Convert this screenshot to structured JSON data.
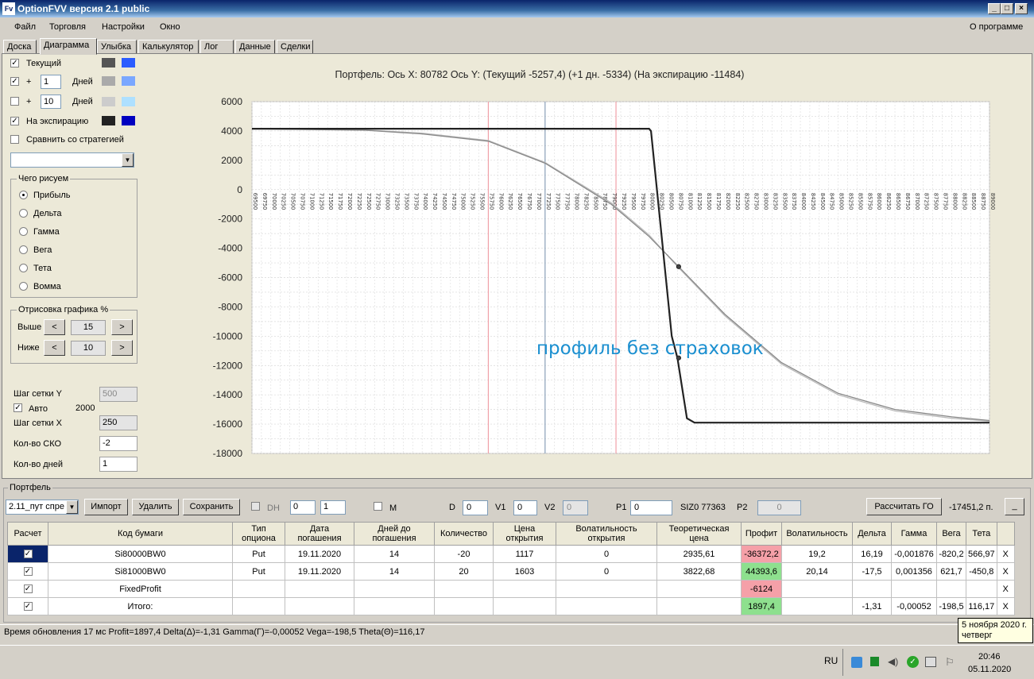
{
  "window": {
    "title": "OptionFVV версия 2.1 public",
    "icon_label": "Fv"
  },
  "menu": {
    "file": "Файл",
    "trade": "Торговля",
    "settings": "Настройки",
    "window": "Окно",
    "about": "О программе"
  },
  "tabs": [
    "Доска",
    "Диаграмма",
    "Улыбка",
    "Калькулятор",
    "Лог",
    "Данные",
    "Сделки"
  ],
  "left": {
    "current_label": "Текущий",
    "plus": "+",
    "days1": "1",
    "days_label": "Дней",
    "days2": "10",
    "expiration_label": "На экспирацию",
    "compare_label": "Сравнить со стратегией",
    "colors": {
      "current": [
        "#555555",
        "#2b5cff"
      ],
      "d1": [
        "#aaaaaa",
        "#7aa7ff"
      ],
      "d10": [
        "#cccccc",
        "#aee0ff"
      ],
      "exp": [
        "#222222",
        "#0000c0"
      ]
    },
    "what_group": "Чего рисуем",
    "radios": [
      "Прибыль",
      "Дельта",
      "Гамма",
      "Вега",
      "Тета",
      "Вомма"
    ],
    "draw_group": "Отрисовка графика %",
    "above_label": "Выше",
    "above_value": "15",
    "below_label": "Ниже",
    "below_value": "10",
    "grid_y_label": "Шаг сетки Y",
    "grid_y_value": "500",
    "auto_label": "Авто",
    "auto_value": "2000",
    "grid_x_label": "Шаг сетки X",
    "grid_x_value": "250",
    "sko_label": "Кол-во СКО",
    "sko_value": "-2",
    "days_count_label": "Кол-во дней",
    "days_count_value": "1",
    "btn_left": "<",
    "btn_right": ">"
  },
  "chart_header": "Портфель: Ось X: 80782 Ось Y:  (Текущий -5257,4)  (+1 дн. -5334)  (На экспирацию -11484)",
  "chart_annotation": "профиль без страховок",
  "chart_data": {
    "type": "line",
    "ylim": [
      -18000,
      6000
    ],
    "xlim": [
      69500,
      89000
    ],
    "y_ticks": [
      6000,
      4000,
      2000,
      0,
      -2000,
      -4000,
      -6000,
      -8000,
      -10000,
      -12000,
      -14000,
      -16000,
      -18000
    ],
    "x_tick_step": 250,
    "vlines": [
      {
        "x": 75750,
        "color": "#f0a0a8"
      },
      {
        "x": 77250,
        "color": "#8aa0b8"
      },
      {
        "x": 79125,
        "color": "#f0a0a8"
      }
    ],
    "series": [
      {
        "color": "#222222",
        "points": [
          [
            69500,
            4150
          ],
          [
            80000,
            4150
          ],
          [
            80050,
            4000
          ],
          [
            80600,
            -10000
          ],
          [
            80750,
            -11500
          ],
          [
            81000,
            -15600
          ],
          [
            81200,
            -15900
          ],
          [
            89000,
            -15900
          ]
        ]
      },
      {
        "color": "#888888",
        "points": [
          [
            69500,
            4150
          ],
          [
            72500,
            4050
          ],
          [
            74000,
            3800
          ],
          [
            75750,
            3300
          ],
          [
            77250,
            1800
          ],
          [
            79000,
            -1000
          ],
          [
            80000,
            -3200
          ],
          [
            80782,
            -5257
          ],
          [
            82000,
            -8500
          ],
          [
            83500,
            -11800
          ],
          [
            85000,
            -13900
          ],
          [
            86500,
            -15000
          ],
          [
            88000,
            -15500
          ],
          [
            89000,
            -15750
          ]
        ]
      },
      {
        "color": "#bbbbbb",
        "points": [
          [
            69500,
            4150
          ],
          [
            72500,
            4070
          ],
          [
            74000,
            3850
          ],
          [
            75750,
            3350
          ],
          [
            77250,
            1850
          ],
          [
            79000,
            -900
          ],
          [
            80000,
            -3100
          ],
          [
            80782,
            -5334
          ],
          [
            82000,
            -8600
          ],
          [
            83500,
            -11900
          ],
          [
            85000,
            -14000
          ],
          [
            86500,
            -15100
          ],
          [
            88000,
            -15600
          ],
          [
            89000,
            -15800
          ]
        ]
      }
    ],
    "markers": [
      [
        80782,
        -5257
      ],
      [
        80782,
        -11484
      ]
    ]
  },
  "portfolio": {
    "title": "Портфель",
    "select": "2.11_пут спре",
    "import": "Импорт",
    "delete": "Удалить",
    "save": "Сохранить",
    "dh": "DH",
    "dh_v1": "0",
    "dh_v2": "1",
    "m": "M",
    "d_label": "D",
    "d_value": "0",
    "v1_label": "V1",
    "v1_value": "0",
    "v2_label": "V2",
    "v2_value": "0",
    "p1_label": "P1",
    "p1_value": "0",
    "siz": "SIZ0 77363",
    "p2_label": "P2",
    "p2_value": "0",
    "calc_go": "Рассчитать ГО",
    "go_value": "-17451,2 п.",
    "minimize": "_"
  },
  "table": {
    "headers": [
      "Расчет",
      "Код бумаги",
      "Тип опциона",
      "Дата погашения",
      "Дней до погашения",
      "Количество",
      "Цена открытия",
      "Волатильность открытия",
      "Теоретическая цена",
      "Профит",
      "Волатильность",
      "Дельта",
      "Гамма",
      "Вега",
      "Тета",
      ""
    ],
    "rows": [
      [
        "",
        "Si80000BW0",
        "Put",
        "19.11.2020",
        "14",
        "-20",
        "1117",
        "0",
        "2935,61",
        "-36372,2",
        "19,2",
        "16,19",
        "-0,001876",
        "-820,2",
        "566,97",
        "X"
      ],
      [
        "",
        "Si81000BW0",
        "Put",
        "19.11.2020",
        "14",
        "20",
        "1603",
        "0",
        "3822,68",
        "44393,6",
        "20,14",
        "-17,5",
        "0,001356",
        "621,7",
        "-450,8",
        "X"
      ],
      [
        "",
        "FixedProfit",
        "",
        "",
        "",
        "",
        "",
        "",
        "",
        "-6124",
        "",
        "",
        "",
        "",
        "",
        "X"
      ],
      [
        "",
        "Итого:",
        "",
        "",
        "",
        "",
        "",
        "",
        "",
        "1897,4",
        "",
        "-1,31",
        "-0,00052",
        "-198,5",
        "116,17",
        "X"
      ]
    ],
    "check": "✓"
  },
  "status": "Время обновления 17 мс  Profit=1897,4 Delta(Δ)=-1,31 Gamma(Γ)=-0,00052 Vega=-198,5 Theta(Θ)=116,17",
  "tooltip": {
    "line1": "5 ноября 2020 г.",
    "line2": "четверг"
  },
  "taskbar": {
    "lang": "RU",
    "time": "20:46",
    "date": "05.11.2020"
  }
}
